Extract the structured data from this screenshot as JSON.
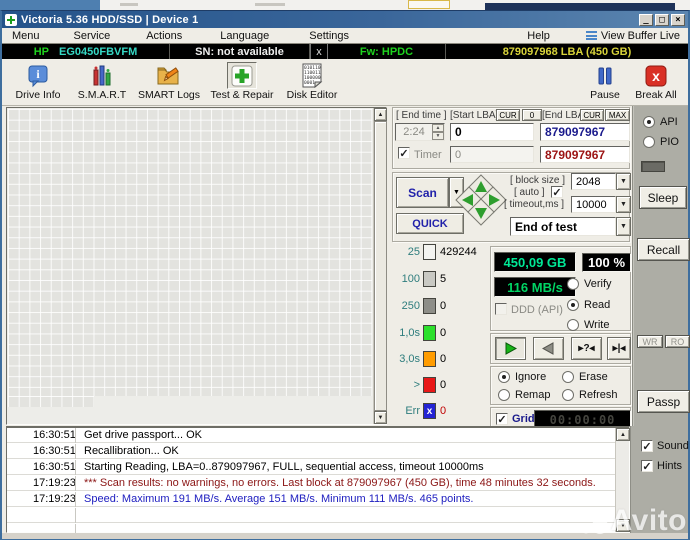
{
  "window": {
    "title": "Victoria 5.36 HDD/SSD | Device 1",
    "minimize": "_",
    "maximize": "□",
    "close": "×"
  },
  "menu": {
    "items": [
      "Menu",
      "Service",
      "Actions",
      "Language",
      "Settings"
    ],
    "help": "Help",
    "view_buffer": "View Buffer Live"
  },
  "info_bar": {
    "vendor": "HP",
    "model": "EG0450FBVFM",
    "serial": "SN: not available",
    "close": "x",
    "firmware": "Fw: HPDC",
    "capacity": "879097968 LBA (450 GB)"
  },
  "toolbar": {
    "drive_info": "Drive Info",
    "smart": "S.M.A.R.T",
    "smart_logs": "SMART Logs",
    "test_repair": "Test & Repair",
    "disk_editor": "Disk Editor",
    "pause": "Pause",
    "break_all": "Break All"
  },
  "test_setup": {
    "end_time_label": "[ End time ]",
    "end_time": "2:24",
    "timer_label": "Timer",
    "start_lba_label": "[Start LBA]",
    "btn_cur": "CUR",
    "btn_zero": "0",
    "start_lba": "0",
    "start_lba_pass": "0",
    "end_lba_label": "[End LBA]",
    "btn_max": "MAX",
    "end_lba": "879097967",
    "end_lba_pass": "879097967",
    "scan": "Scan",
    "quick": "QUICK",
    "block_size_label": "[ block size ]",
    "block_size": "2048",
    "auto_label": "[ auto ]",
    "timeout_label": "[ timeout,ms ]",
    "timeout": "10000",
    "end_of_test": "End of test"
  },
  "legend": [
    {
      "label": "25",
      "count": "429244",
      "color": "#f4f4f0",
      "count_color": "#000000",
      "mark": ""
    },
    {
      "label": "100",
      "count": "5",
      "color": "#c9c9c3",
      "count_color": "#000000",
      "mark": ""
    },
    {
      "label": "250",
      "count": "0",
      "color": "#8e8e88",
      "count_color": "#000000",
      "mark": ""
    },
    {
      "label": "1,0s",
      "count": "0",
      "color": "#2ce02c",
      "count_color": "#000000",
      "mark": ""
    },
    {
      "label": "3,0s",
      "count": "0",
      "color": "#ff9c00",
      "count_color": "#000000",
      "mark": ""
    },
    {
      "label": ">",
      "count": "0",
      "color": "#e81818",
      "count_color": "#000000",
      "mark": ""
    },
    {
      "label": "Err",
      "count": "0",
      "color": "#2424d4",
      "count_color": "#c00000",
      "mark": "x"
    }
  ],
  "progress": {
    "capacity": "450,09 GB",
    "capacity_color": "#00E896",
    "percent": "100",
    "percent_unit": "%",
    "speed": "116 MB/s",
    "speed_color": "#00D464",
    "ddd_label": "DDD (API)",
    "verify": "Verify",
    "read": "Read",
    "write": "Write"
  },
  "defect_actions": {
    "ignore": "Ignore",
    "erase": "Erase",
    "remap": "Remap",
    "refresh": "Refresh"
  },
  "grid_toggle": {
    "label": "Grid",
    "elapsed": "00:00:00"
  },
  "side_panel": {
    "api": "API",
    "pio": "PIO",
    "sleep": "Sleep",
    "recall": "Recall",
    "wr": "WR",
    "ro": "RO",
    "passp": "Passp"
  },
  "log": {
    "rows": [
      {
        "time": "16:30:51",
        "message": "Get drive passport... OK",
        "color": "#000000"
      },
      {
        "time": "16:30:51",
        "message": "Recallibration... OK",
        "color": "#000000"
      },
      {
        "time": "16:30:51",
        "message": "Starting Reading, LBA=0..879097967, FULL, sequential access, timeout 10000ms",
        "color": "#000000"
      },
      {
        "time": "17:19:23",
        "message": "*** Scan results: no warnings, no errors. Last block at 879097967 (450 GB), time 48 minutes 32 seconds.",
        "color": "#8b1515"
      },
      {
        "time": "17:19:23",
        "message": "Speed: Maximum 191 MB/s. Average 151 MB/s. Minimum 111 MB/s. 465 points.",
        "color": "#2020c0"
      }
    ]
  },
  "footer": {
    "sound": "Sound",
    "hints": "Hints"
  },
  "watermark": {
    "text": "Avito"
  }
}
